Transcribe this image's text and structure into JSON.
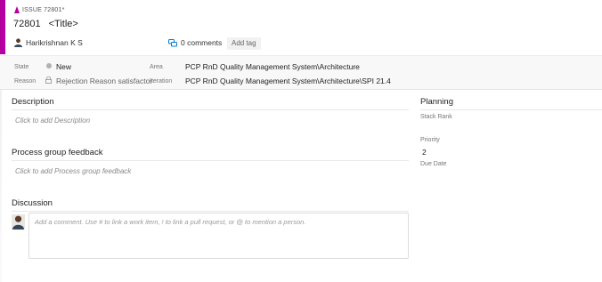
{
  "colors": {
    "accent": "#b4009e",
    "state_new": "#b2b2b2"
  },
  "header": {
    "type_icon": "bug-icon",
    "type_label": "ISSUE 72801*",
    "id": "72801",
    "title": "<Title>",
    "assignee": "Harikrishnan K S",
    "comments_icon": "comment-icon",
    "comments_label": "0 comments",
    "add_tag_label": "Add tag"
  },
  "fields": {
    "state_label": "State",
    "state_value": "New",
    "reason_label": "Reason",
    "reason_value": "Rejection Reason satisfactor",
    "area_label": "Area",
    "area_value": "PCP RnD Quality Management System\\Architecture",
    "iteration_label": "Iteration",
    "iteration_value": "PCP RnD Quality Management System\\Architecture\\SPI 21.4"
  },
  "sections": {
    "description_title": "Description",
    "description_placeholder": "Click to add Description",
    "process_title": "Process group feedback",
    "process_placeholder": "Click to add Process group feedback",
    "discussion_title": "Discussion",
    "discussion_placeholder": "Add a comment. Use # to link a work item, ! to link a pull request, or @ to mention a person."
  },
  "planning": {
    "title": "Planning",
    "stack_rank_label": "Stack Rank",
    "priority_label": "Priority",
    "priority_value": "2",
    "due_date_label": "Due Date"
  }
}
